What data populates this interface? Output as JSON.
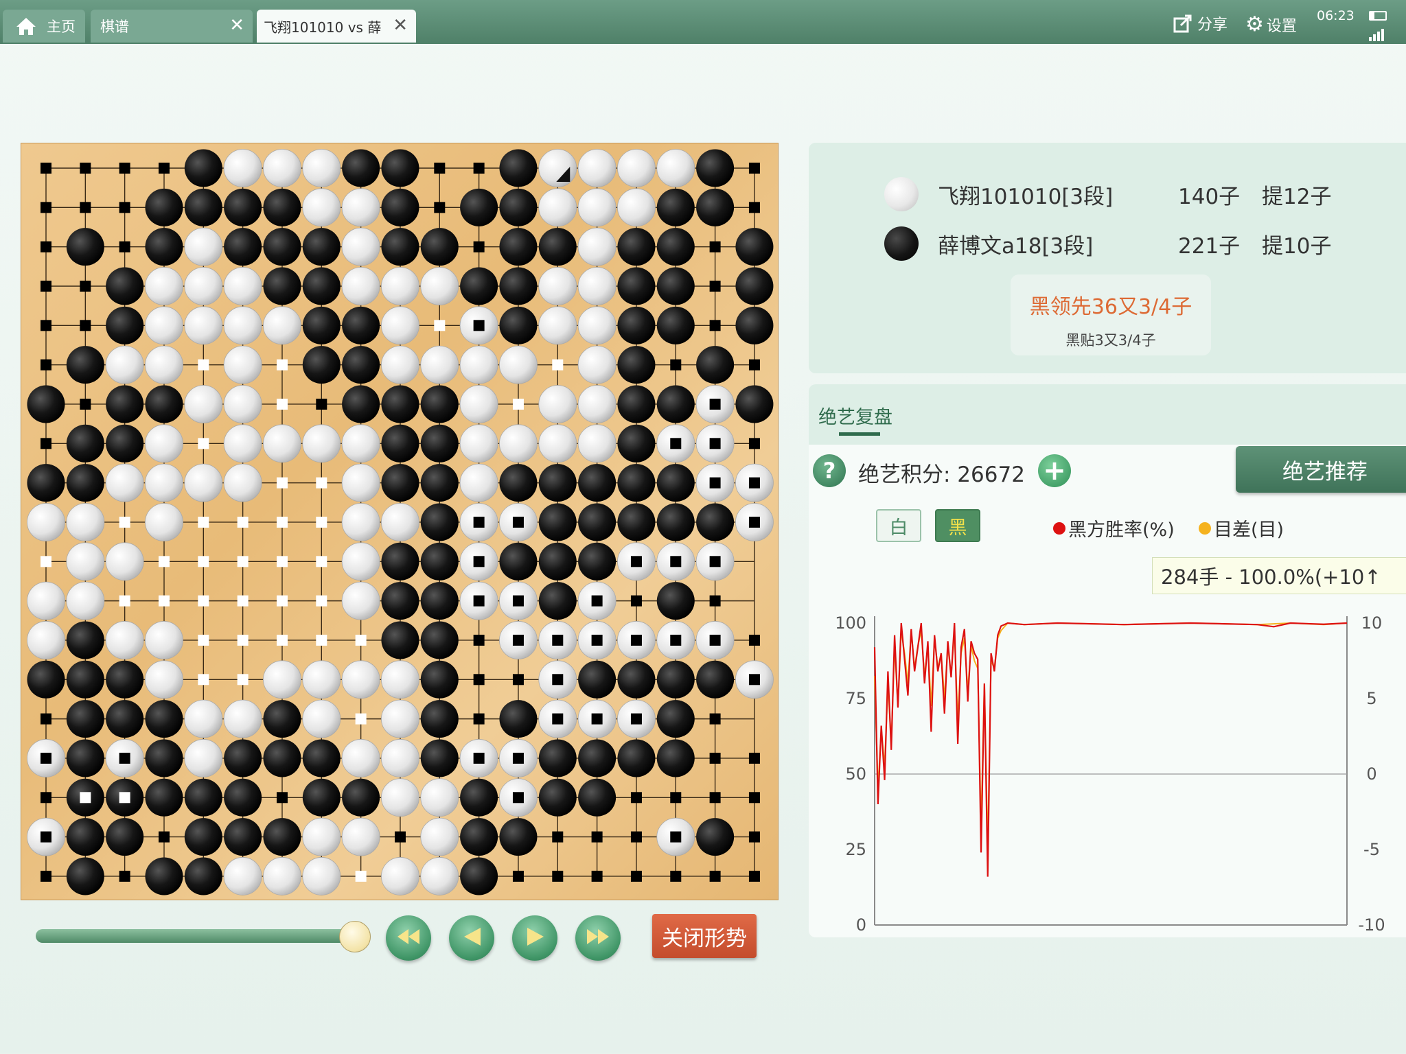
{
  "tabs": [
    {
      "label": "主页",
      "icon": "home-icon"
    },
    {
      "label": "棋谱",
      "closable": true
    },
    {
      "label": "飞翔101010 vs 薛",
      "closable": true,
      "active": true
    }
  ],
  "topbar": {
    "share_label": "分享",
    "settings_label": "设置",
    "time": "06:23"
  },
  "players": [
    {
      "color": "white",
      "name": "飞翔101010[3段]",
      "stones": "140子",
      "captures": "提12子"
    },
    {
      "color": "black",
      "name": "薛博文a18[3段]",
      "stones": "221子",
      "captures": "提10子"
    }
  ],
  "result": {
    "lead": "黑领先36又3/4子",
    "komi": "黑贴3又3/4子"
  },
  "analysis": {
    "tab_label": "绝艺复盘",
    "score_label": "绝艺积分: 26672",
    "recommend_label": "绝艺推荐",
    "toggle_white": "白",
    "toggle_black": "黑",
    "legend_winrate": "黑方胜率(%)",
    "legend_margin": "目差(目)",
    "tooltip": "284手 - 100.0%(+10↑"
  },
  "chart_data": {
    "type": "line",
    "left_axis_ticks": [
      "100",
      "75",
      "50",
      "25",
      "0"
    ],
    "right_axis_ticks": [
      "10",
      "5",
      "0",
      "-5",
      "-10"
    ],
    "ylim_left": [
      0,
      100
    ],
    "ylim_right": [
      -10,
      10
    ],
    "xlim": [
      0,
      284
    ],
    "series": [
      {
        "name": "黑方胜率(%)",
        "color": "#dd1111",
        "x": [
          0,
          2,
          4,
          6,
          8,
          10,
          12,
          14,
          16,
          18,
          20,
          22,
          24,
          26,
          28,
          30,
          32,
          34,
          36,
          38,
          40,
          42,
          44,
          46,
          48,
          50,
          52,
          54,
          56,
          58,
          60,
          62,
          64,
          66,
          68,
          70,
          72,
          74,
          76,
          80,
          90,
          110,
          150,
          190,
          230,
          240,
          250,
          270,
          284
        ],
        "y": [
          92,
          40,
          66,
          48,
          84,
          58,
          96,
          72,
          100,
          88,
          76,
          98,
          84,
          92,
          100,
          80,
          94,
          64,
          96,
          84,
          90,
          70,
          94,
          82,
          100,
          60,
          92,
          98,
          74,
          94,
          90,
          88,
          24,
          80,
          16,
          90,
          84,
          96,
          99,
          100,
          99.5,
          100,
          99.5,
          100,
          99.5,
          98.8,
          100,
          99.6,
          100
        ]
      },
      {
        "name": "目差(目)",
        "color": "#f5b21e",
        "x": [
          0,
          2,
          4,
          6,
          8,
          10,
          12,
          14,
          16,
          18,
          20,
          22,
          24,
          26,
          28,
          30,
          32,
          34,
          36,
          38,
          40,
          42,
          44,
          46,
          48,
          50,
          52,
          54,
          56,
          58,
          60,
          62,
          64,
          66,
          68,
          70,
          72,
          74,
          76,
          80,
          90,
          110,
          150,
          190,
          230,
          250,
          270,
          284
        ],
        "y": [
          6.5,
          -1,
          3,
          0.5,
          6,
          2,
          8.5,
          4.5,
          9.5,
          8,
          6,
          9.5,
          7,
          8.5,
          9.5,
          6.5,
          8.5,
          4.5,
          9,
          7,
          8,
          5,
          8.5,
          6.5,
          9.5,
          3.5,
          8,
          9,
          5.5,
          8.5,
          7.5,
          7,
          -3.5,
          6,
          -5,
          7.5,
          7,
          9,
          9.5,
          10,
          9.9,
          10,
          9.9,
          10,
          9.9,
          10,
          9.9,
          10
        ]
      }
    ],
    "grid": false,
    "midline": 50
  },
  "board": {
    "size": 19,
    "rows": [
      "xxxxbwwwbbxxbwwwwbx",
      "xxxbbbbwwbxbbwwwbbX",
      "xbxbwbbbwbbxbbwbbxb",
      "xxbwwwbbwwwbbwwbbxb",
      "xxbwwwwbbwoWbwwbbxb",
      "xbwwowobbwwwwowbxbx",
      "bxbbwwoxbbbwowwbbWb",
      "xbbwowwwwbbwwwwbWWx",
      "bbwwwwoowbbwbbbbbWW",
      "wwowoooowwbWWbbbbbW",
      "owwooooowbbWbbbWWW",
      "wwoooooowbbWWbWxbx",
      "wbwwooooobbxWWWWWWx",
      "bbbwoowwwwbxxWbbbbW",
      "xbbbwwbwowbxbWWWbx",
      "WbWbwbbbwwbWWbbbbxx",
      "xBBbbbxbbwwbWbbxxxx",
      "WbbxbbbwwxwbbxxxWbx",
      "xbxbbwwwowwbxxxxxxx"
    ],
    "last_move": {
      "col": 13,
      "row": 0
    }
  }
}
